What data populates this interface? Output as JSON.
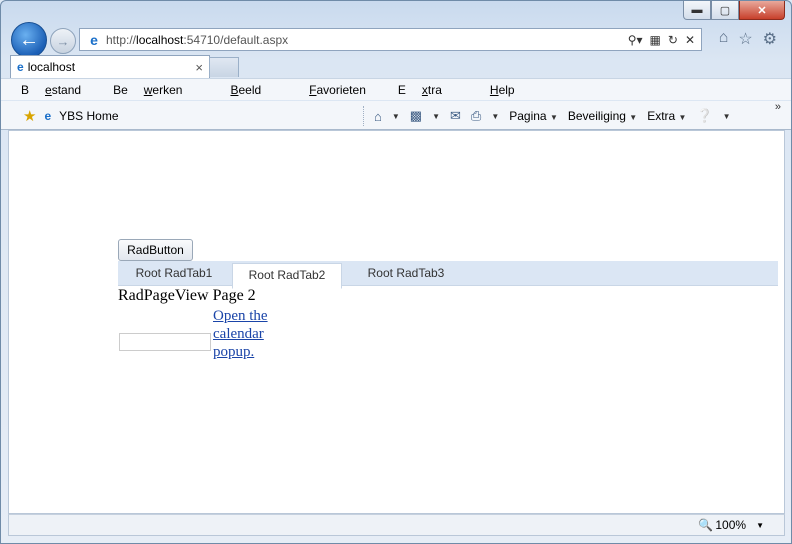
{
  "window": {
    "controls": {
      "minimize": "▬",
      "maximize": "▢",
      "close": "✕"
    }
  },
  "address_bar": {
    "url_prefix": "http://",
    "url_host": "localhost",
    "url_rest": ":54710/default.aspx",
    "tools": [
      "search-icon",
      "compat-icon",
      "refresh-icon",
      "stop-icon"
    ]
  },
  "tab": {
    "title": "localhost",
    "close": "×"
  },
  "menu": [
    {
      "pre": "B",
      "accel": "e",
      "post": "stand"
    },
    {
      "pre": "Be",
      "accel": "w",
      "post": "erken"
    },
    {
      "pre": "",
      "accel": "B",
      "post": "eeld"
    },
    {
      "pre": "",
      "accel": "F",
      "post": "avorieten"
    },
    {
      "pre": "E",
      "accel": "x",
      "post": "tra"
    },
    {
      "pre": "",
      "accel": "H",
      "post": "elp"
    }
  ],
  "favorites": {
    "item": "YBS Home"
  },
  "commands": {
    "pagina": "Pagina",
    "beveiliging": "Beveiliging",
    "extra": "Extra",
    "more": "»"
  },
  "page": {
    "button_label": "RadButton",
    "tabs": [
      "Root RadTab1",
      "Root RadTab2",
      "Root RadTab3"
    ],
    "selected_tab": 1,
    "pageview_text": "RadPageView Page 2",
    "calendar_link": "Open the calendar popup."
  },
  "status": {
    "zoom": "100%"
  }
}
